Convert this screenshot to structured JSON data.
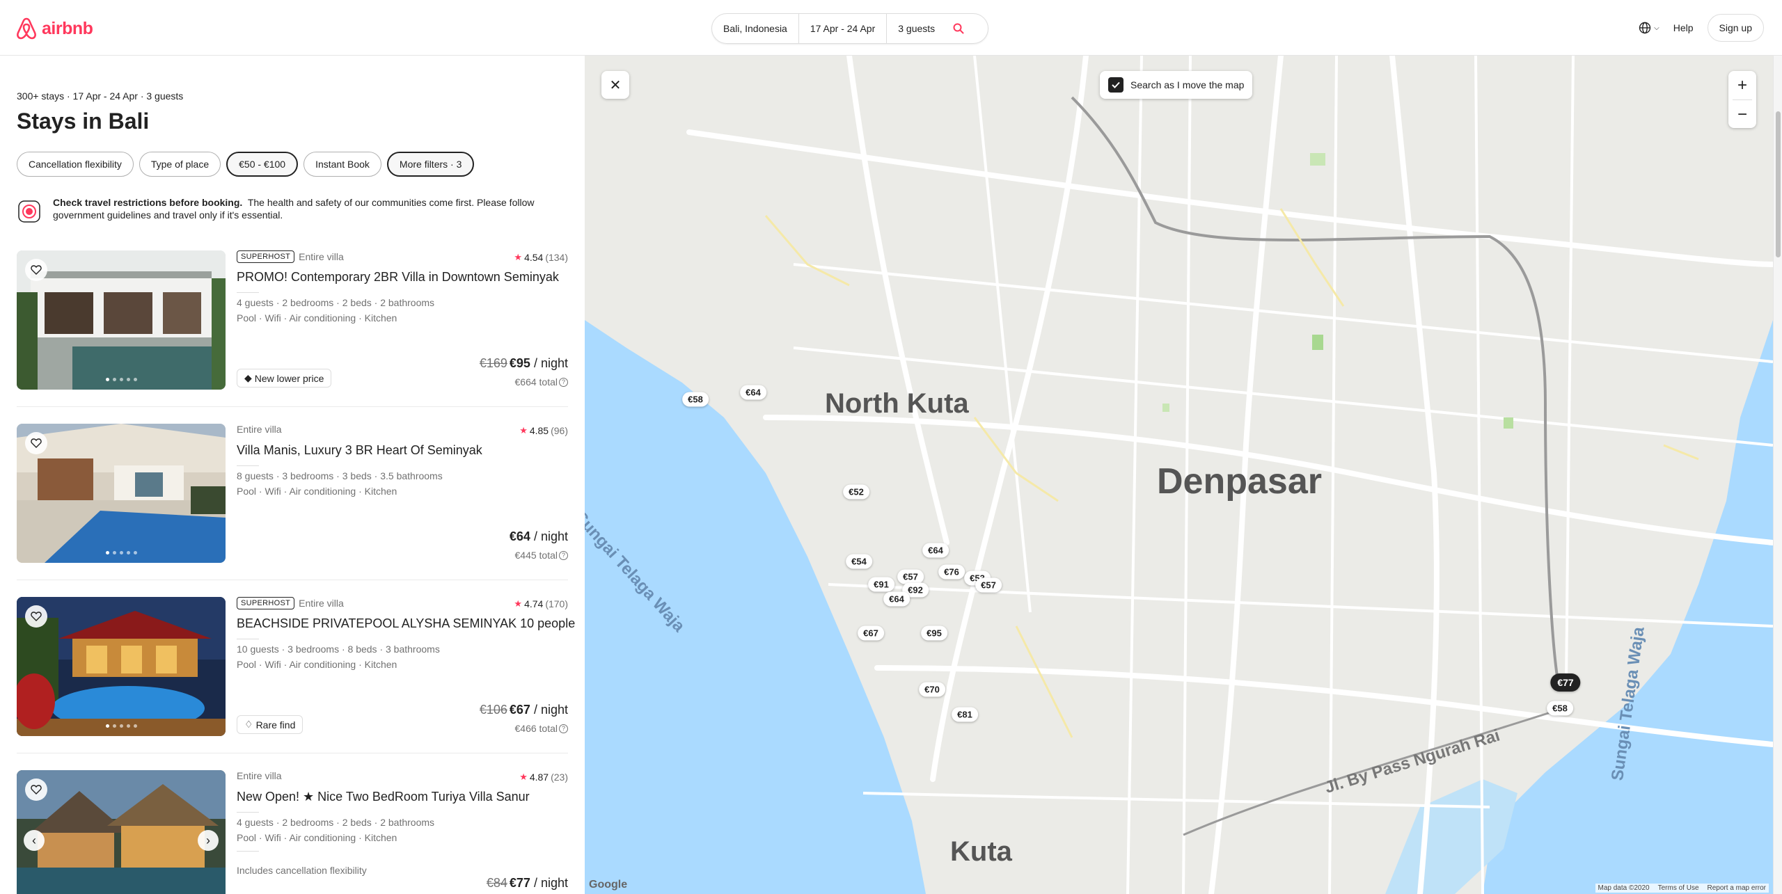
{
  "header": {
    "logo_text": "airbnb",
    "search": {
      "location": "Bali, Indonesia",
      "dates": "17 Apr - 24 Apr",
      "guests": "3 guests"
    },
    "help_label": "Help",
    "signup_label": "Sign up"
  },
  "results": {
    "meta": "300+ stays · 17 Apr - 24 Apr · 3 guests",
    "title": "Stays in Bali",
    "filters": [
      "Cancellation flexibility",
      "Type of place",
      "€50 - €100",
      "Instant Book",
      "More filters · 3"
    ],
    "notice_bold": "Check travel restrictions before booking.",
    "notice_text": "The health and safety of our communities come first. Please follow government guidelines and travel only if it's essential."
  },
  "listings": [
    {
      "superhost": "SUPERHOST",
      "type": "Entire villa",
      "rating": "4.54",
      "reviews": "(134)",
      "title": "PROMO! Contemporary 2BR Villa in Downtown Seminyak",
      "details": "4 guests · 2 bedrooms · 2 beds · 2 bathrooms",
      "amenities": "Pool · Wifi · Air conditioning · Kitchen",
      "badge": "New lower price",
      "old_price": "€169",
      "price": "€95",
      "per": " / night",
      "total": "€664 total"
    },
    {
      "superhost": "",
      "type": "Entire villa",
      "rating": "4.85",
      "reviews": "(96)",
      "title": "Villa Manis, Luxury 3 BR Heart Of Seminyak",
      "details": "8 guests · 3 bedrooms · 3 beds · 3.5 bathrooms",
      "amenities": "Pool · Wifi · Air conditioning · Kitchen",
      "badge": "",
      "old_price": "",
      "price": "€64",
      "per": " / night",
      "total": "€445 total"
    },
    {
      "superhost": "SUPERHOST",
      "type": "Entire villa",
      "rating": "4.74",
      "reviews": "(170)",
      "title": "BEACHSIDE PRIVATEPOOL ALYSHA SEMINYAK 10 people",
      "details": "10 guests · 3 bedrooms · 8 beds · 3 bathrooms",
      "amenities": "Pool · Wifi · Air conditioning · Kitchen",
      "badge": "Rare find",
      "old_price": "€106",
      "price": "€67",
      "per": " / night",
      "total": "€466 total"
    },
    {
      "superhost": "",
      "type": "Entire villa",
      "rating": "4.87",
      "reviews": "(23)",
      "title": "New Open! ★ Nice Two BedRoom Turiya Villa Sanur",
      "details": "4 guests · 2 bedrooms · 2 beds · 2 bathrooms",
      "amenities": "Pool · Wifi · Air conditioning · Kitchen",
      "cancellation": "Includes cancellation flexibility",
      "badge": "",
      "old_price": "€84",
      "price": "€77",
      "per": " / night",
      "total": ""
    }
  ],
  "map": {
    "search_as_move": "Search as I move the map",
    "labels": {
      "north_kuta": "North Kuta",
      "denpasar": "Denpasar",
      "kuta": "Kuta",
      "river_left": "Sungai Telaga Waja",
      "river_right": "Sungai Telaga Waja",
      "bypass": "Jl. By Pass Ngurah Rai"
    },
    "pins": [
      "€58",
      "€64",
      "€52",
      "€64",
      "€54",
      "€57",
      "€76",
      "€53",
      "€57",
      "€91",
      "€92",
      "€64",
      "€67",
      "€95",
      "€70",
      "€81",
      "€77",
      "€58"
    ],
    "google": "Google",
    "footer": [
      "Map data ©2020",
      "Terms of Use",
      "Report a map error"
    ]
  },
  "colors": {
    "brand": "#ff385c",
    "water": "#aadaff",
    "land": "#e9e9e4"
  }
}
